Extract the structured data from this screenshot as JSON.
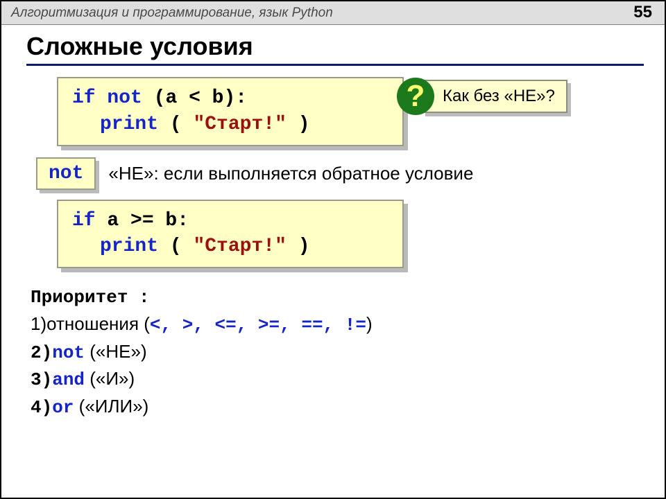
{
  "header": {
    "course": "Алгоритмизация и программирование, язык Python",
    "page": "55"
  },
  "title": "Сложные условия",
  "code1": {
    "line1_if": "if",
    "line1_not": "not",
    "line1_expr": "(a < b):",
    "line2_print": "print",
    "line2_open": "(",
    "line2_str": "\"Старт!\"",
    "line2_close": ")"
  },
  "callout": {
    "mark": "?",
    "text": "Как без «НЕ»?"
  },
  "notchip": "not",
  "notdesc": "«НЕ»: если выполняется обратное условие",
  "code2": {
    "line1_if": "if",
    "line1_expr": "a >= b:",
    "line2_print": "print",
    "line2_open": "(",
    "line2_str": "\"Старт!\"",
    "line2_close": ")"
  },
  "priority": {
    "header": "Приоритет :",
    "r1_num": "1)",
    "r1_txt": "отношения (",
    "r1_ops": "<, >, <=, >=, ==, !=",
    "r1_close": ")",
    "r2_num": "2)",
    "r2_kw": "not",
    "r2_txt": " («НЕ»)",
    "r3_num": "3)",
    "r3_kw": "and",
    "r3_txt": " («И»)",
    "r4_num": "4)",
    "r4_kw": "or",
    "r4_txt": " («ИЛИ»)"
  }
}
